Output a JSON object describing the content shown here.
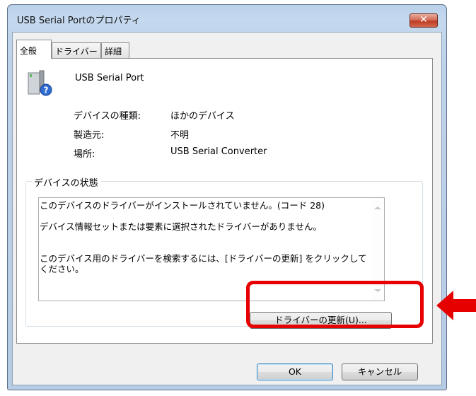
{
  "window": {
    "title": "USB Serial Portのプロパティ",
    "close_glyph": "✕"
  },
  "tabs": [
    {
      "label": "全般",
      "active": true
    },
    {
      "label": "ドライバー",
      "active": false
    },
    {
      "label": "詳細",
      "active": false
    }
  ],
  "device": {
    "icon": "usb-serial-device-unknown-icon",
    "name": "USB Serial Port",
    "properties": [
      {
        "label": "デバイスの種類:",
        "value": "ほかのデバイス"
      },
      {
        "label": "製造元:",
        "value": "不明"
      },
      {
        "label": "場所:",
        "value": "USB Serial Converter"
      }
    ]
  },
  "status": {
    "group_label": "デバイスの状態",
    "lines": [
      "このデバイスのドライバーがインストールされていません。(コード 28)",
      "デバイス情報セットまたは要素に選択されたドライバーがありません。",
      "このデバイス用のドライバーを検索するには、[ドライバーの更新] をクリックしてください。"
    ],
    "update_button": "ドライバーの更新(U)..."
  },
  "buttons": {
    "ok": "OK",
    "cancel": "キャンセル"
  },
  "colors": {
    "highlight": "#e60000",
    "arrow": "#e60000"
  }
}
